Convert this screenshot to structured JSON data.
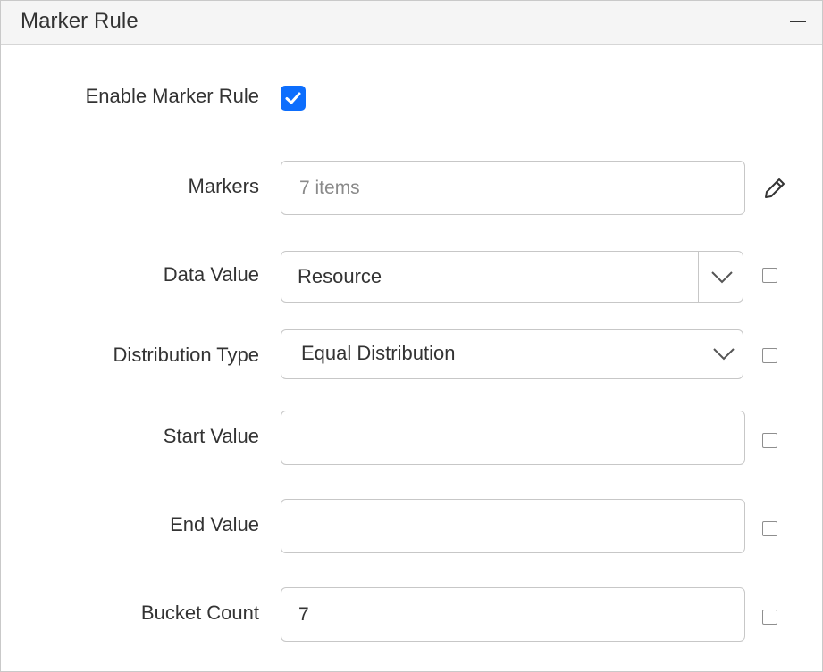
{
  "panel": {
    "title": "Marker Rule",
    "collapse_icon": "minus-icon"
  },
  "enable_marker_rule": {
    "label": "Enable Marker Rule",
    "checked": true,
    "accent": "#0d6efd"
  },
  "markers": {
    "label": "Markers",
    "placeholder": "7 items",
    "edit_icon": "pencil-icon"
  },
  "data_value": {
    "label": "Data Value",
    "value": "Resource",
    "icon": "chevron-down-icon"
  },
  "distribution_type": {
    "label": "Distribution Type",
    "value": "Equal Distribution",
    "icon": "chevron-down-icon"
  },
  "start_value": {
    "label": "Start Value",
    "value": ""
  },
  "end_value": {
    "label": "End Value",
    "value": ""
  },
  "bucket_count": {
    "label": "Bucket Count",
    "value": "7"
  }
}
